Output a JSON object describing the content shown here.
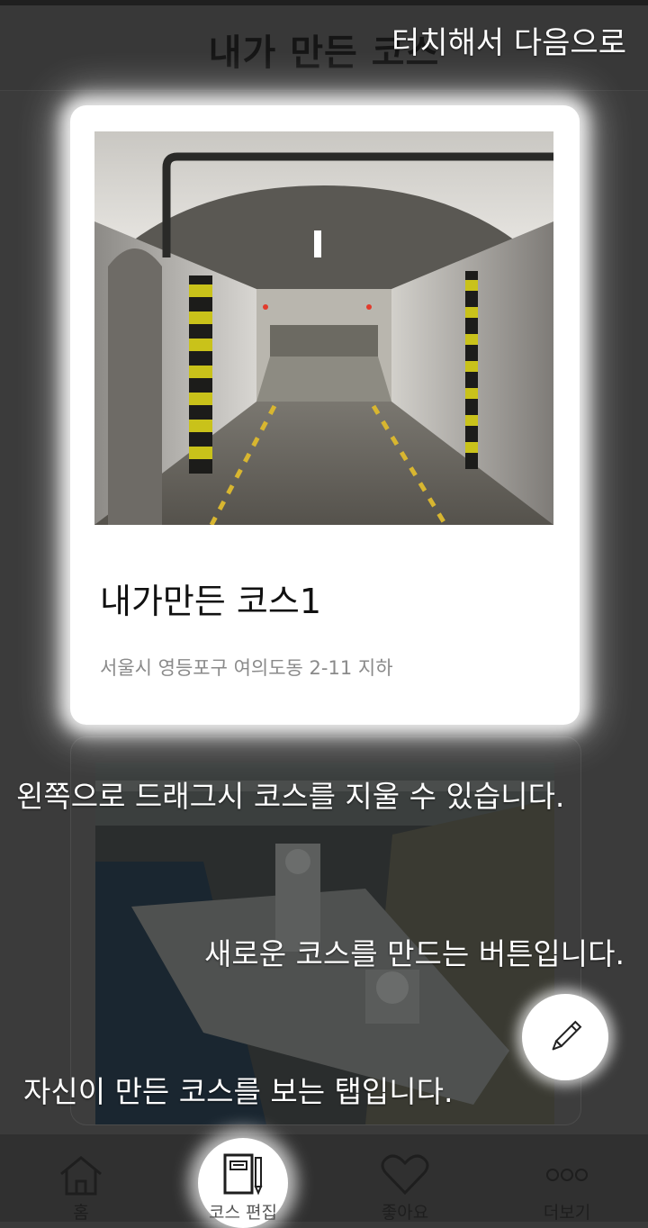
{
  "header": {
    "title": "내가 만든 코스"
  },
  "tips": {
    "next": "터치해서 다음으로",
    "drag_delete": "왼쪽으로 드래그시 코스를 지울 수 있습니다.",
    "new_course": "새로운 코스를 만드는 버튼입니다.",
    "my_tab": "자신이 만든 코스를 보는 탭입니다."
  },
  "courses": [
    {
      "title": "내가만든 코스1",
      "address": "서울시 영등포구 여의도동 2-11 지하",
      "image_icon": "tunnel-photo"
    },
    {
      "image_icon": "warship-photo"
    }
  ],
  "fab": {
    "icon": "pencil-icon"
  },
  "bottom_nav": [
    {
      "label": "홈",
      "icon": "home-icon"
    },
    {
      "label": "코스 편집",
      "icon": "notebook-icon",
      "active": true
    },
    {
      "label": "좋아요",
      "icon": "heart-icon"
    },
    {
      "label": "더보기",
      "icon": "more-icon"
    }
  ]
}
